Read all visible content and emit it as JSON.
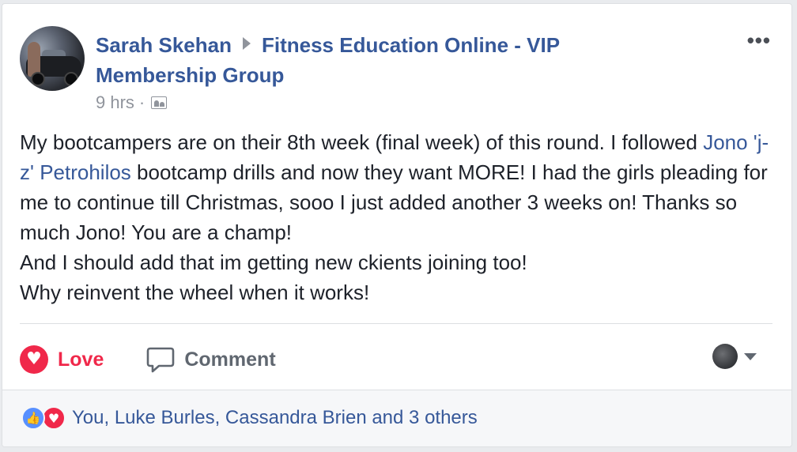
{
  "post": {
    "author": "Sarah Skehan",
    "group": "Fitness Education Online - VIP Membership Group",
    "time": "9 hrs",
    "separator": "·",
    "audience_icon": "group-audience-icon",
    "more_icon": "more-options-icon",
    "more_glyph": "•••",
    "body": {
      "line1": "My bootcampers are on their 8th week (final week) of this round. I followed ",
      "mention": "Jono 'j-z' Petrohilos",
      "line1_end": " bootcamp drills and now they want MORE! I had the girls pleading for me to continue till Christmas, sooo I just added another 3 weeks on! Thanks so much Jono! You are a champ!",
      "line2": "And I should add that im getting new ckients joining too!",
      "line3": "Why reinvent the wheel when it works!"
    }
  },
  "actions": {
    "love_label": "Love",
    "love_icon": "heart-icon",
    "comment_label": "Comment",
    "comment_icon": "speech-bubble-icon"
  },
  "reactions": {
    "icons": [
      "like-icon",
      "love-icon"
    ],
    "summary": "You, Luke Burles, Cassandra Brien and 3 others"
  },
  "colors": {
    "link": "#365899",
    "love": "#f0284a",
    "like": "#5890ff",
    "text": "#1d2129",
    "meta": "#90949c"
  }
}
